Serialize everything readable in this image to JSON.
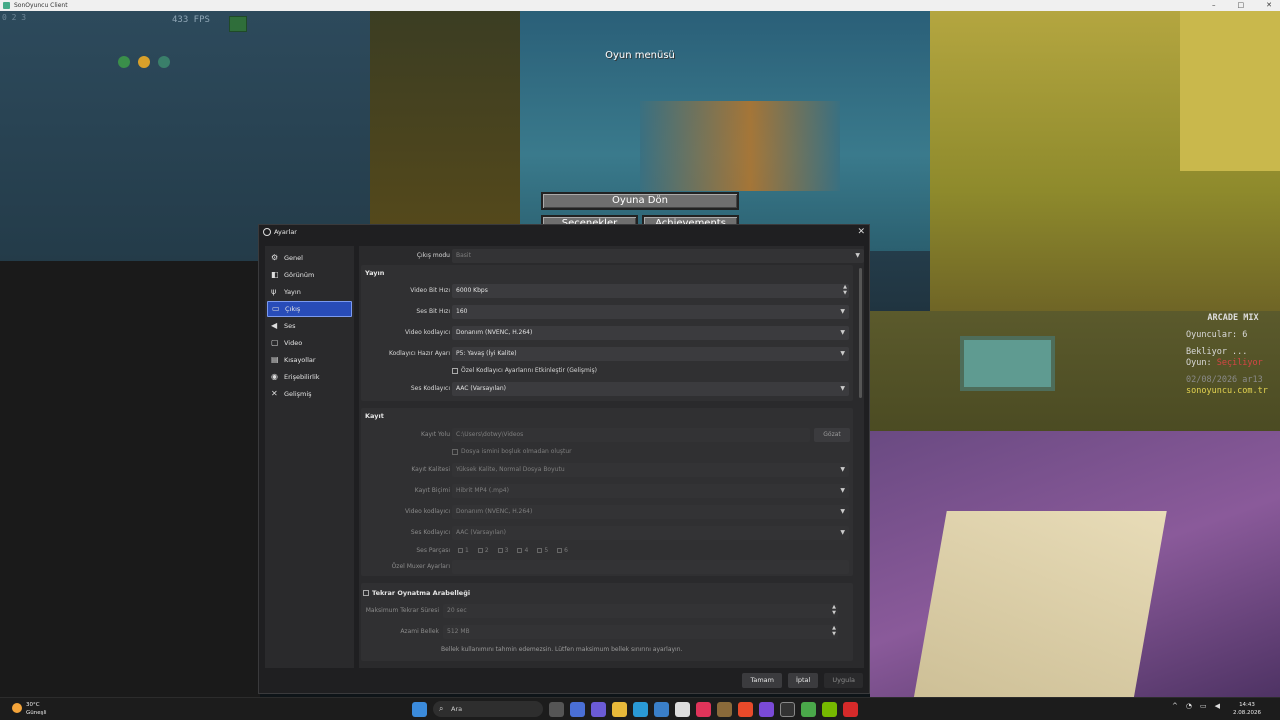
{
  "window": {
    "title": "SonOyuncu Client",
    "controls": [
      "–",
      "□",
      "✕"
    ]
  },
  "game": {
    "fps": "433 FPS",
    "coords": "0 2 3",
    "menu_title": "Oyun menüsü",
    "return_button": "Oyuna Dön",
    "settings_button": "Seçenekler",
    "achievements_button": "Achievements",
    "scoreboard": {
      "title": "ARCADE MIX",
      "players": "Oyuncular: 6",
      "waiting": "Bekliyor ...",
      "game_label": "Oyun:",
      "game_value": "Seçiliyor",
      "date": "02/08/2026 ar13",
      "site": "sonoyuncu.com.tr"
    }
  },
  "dialog": {
    "title": "Ayarlar",
    "sidebar": [
      {
        "label": "Genel",
        "icon": "gear-icon",
        "glyph": "⚙"
      },
      {
        "label": "Görünüm",
        "icon": "palette-icon",
        "glyph": "◧"
      },
      {
        "label": "Yayın",
        "icon": "antenna-icon",
        "glyph": "ψ"
      },
      {
        "label": "Çıkış",
        "icon": "output-icon",
        "glyph": "▭"
      },
      {
        "label": "Ses",
        "icon": "speaker-icon",
        "glyph": "◀"
      },
      {
        "label": "Video",
        "icon": "monitor-icon",
        "glyph": "▢"
      },
      {
        "label": "Kısayollar",
        "icon": "keyboard-icon",
        "glyph": "▤"
      },
      {
        "label": "Erişebilirlik",
        "icon": "accessibility-icon",
        "glyph": "◉"
      },
      {
        "label": "Gelişmiş",
        "icon": "tools-icon",
        "glyph": "✕"
      }
    ],
    "output_mode": {
      "label": "Çıkış modu",
      "value": "Basit"
    },
    "stream": {
      "title": "Yayın",
      "video_bitrate": {
        "label": "Video Bit Hızı",
        "value": "6000 Kbps"
      },
      "audio_bitrate": {
        "label": "Ses Bit Hızı",
        "value": "160"
      },
      "video_encoder": {
        "label": "Video kodlayıcı",
        "value": "Donanım (NVENC, H.264)"
      },
      "encoder_preset": {
        "label": "Kodlayıcı Hazır Ayarı",
        "value": "P5: Yavaş (İyi Kalite)"
      },
      "custom_encoder_checkbox": "Özel Kodlayıcı Ayarlarını Etkinleştir (Gelişmiş)",
      "audio_encoder": {
        "label": "Ses Kodlayıcı",
        "value": "AAC (Varsayılan)"
      }
    },
    "recording": {
      "title": "Kayıt",
      "path": {
        "label": "Kayıt Yolu",
        "value": "C:\\Users\\dotwy\\Videos",
        "browse": "Gözat"
      },
      "no_space_checkbox": "Dosya ismini boşluk olmadan oluştur",
      "quality": {
        "label": "Kayıt Kalitesi",
        "value": "Yüksek Kalite, Normal Dosya Boyutu"
      },
      "format": {
        "label": "Kayıt Biçimi",
        "value": "Hibrit MP4 (.mp4)"
      },
      "video_encoder": {
        "label": "Video kodlayıcı",
        "value": "Donanım (NVENC, H.264)"
      },
      "audio_encoder": {
        "label": "Ses Kodlayıcı",
        "value": "AAC (Varsayılan)"
      },
      "tracks": {
        "label": "Ses Parçası",
        "items": [
          "1",
          "2",
          "3",
          "4",
          "5",
          "6"
        ]
      },
      "muxer": {
        "label": "Özel Muxer Ayarları",
        "value": ""
      }
    },
    "replay": {
      "title": "Tekrar Oynatma Arabelleği",
      "max_time": {
        "label": "Maksimum Tekrar Süresi",
        "value": "20 sec"
      },
      "max_memory": {
        "label": "Azami Bellek",
        "value": "512 MB"
      },
      "note": "Bellek kullanımını tahmin edemezsin. Lütfen maksimum bellek sınırını ayarlayın."
    },
    "buttons": {
      "ok": "Tamam",
      "cancel": "İptal",
      "apply": "Uygula"
    }
  },
  "taskbar": {
    "weather_temp": "30°C",
    "weather_desc": "Güneşli",
    "search_placeholder": "Ara",
    "time": "14:43",
    "date": "2.08.2026"
  }
}
